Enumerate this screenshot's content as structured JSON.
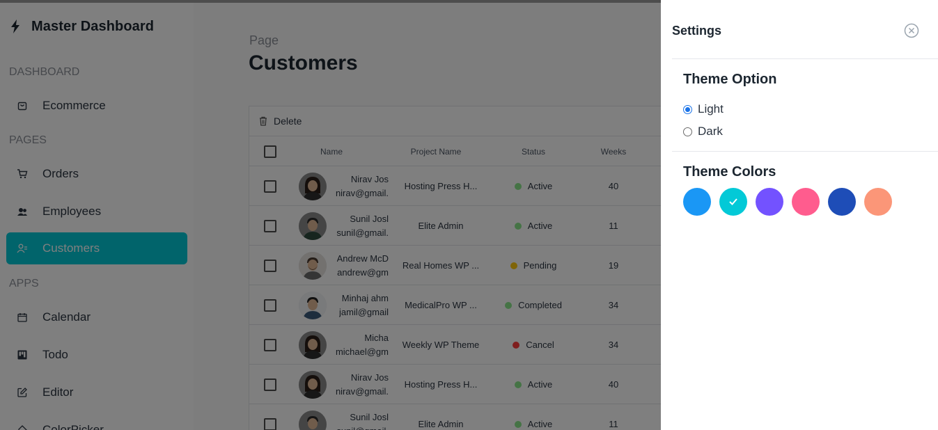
{
  "sidebar": {
    "brand": "Master Dashboard",
    "sections": [
      {
        "title": "Dashboard",
        "items": [
          {
            "label": "Ecommerce",
            "icon": "shopping-bag-icon"
          }
        ]
      },
      {
        "title": "Pages",
        "items": [
          {
            "label": "Orders",
            "icon": "cart-icon"
          },
          {
            "label": "Employees",
            "icon": "employees-icon"
          },
          {
            "label": "Customers",
            "icon": "customers-icon",
            "active": true
          }
        ]
      },
      {
        "title": "Apps",
        "items": [
          {
            "label": "Calendar",
            "icon": "calendar-icon"
          },
          {
            "label": "Todo",
            "icon": "kanban-icon"
          },
          {
            "label": "Editor",
            "icon": "edit-icon"
          },
          {
            "label": "ColorPicker",
            "icon": "color-picker-icon"
          }
        ]
      }
    ]
  },
  "page": {
    "kicker": "Page",
    "title": "Customers"
  },
  "grid": {
    "toolbar_delete": "Delete",
    "headers": {
      "name": "Name",
      "project": "Project Name",
      "status": "Status",
      "weeks": "Weeks"
    },
    "rows": [
      {
        "name": "Nirav Jos",
        "email": "nirav@gmail.",
        "project": "Hosting Press H...",
        "status": "Active",
        "status_color": "#8BE78B",
        "weeks": "40",
        "avatar": "woman"
      },
      {
        "name": "Sunil Josl",
        "email": "sunil@gmail.",
        "project": "Elite Admin",
        "status": "Active",
        "status_color": "#8BE78B",
        "weeks": "11",
        "avatar": "man-dark"
      },
      {
        "name": "Andrew McD",
        "email": "andrew@gm",
        "project": "Real Homes WP ...",
        "status": "Pending",
        "status_color": "#FEC90F",
        "weeks": "19",
        "avatar": "man-beard"
      },
      {
        "name": "Minhaj ahm",
        "email": "jamil@gmail",
        "project": "MedicalPro WP ...",
        "status": "Completed",
        "status_color": "#8BE78B",
        "weeks": "34",
        "avatar": "man-standing"
      },
      {
        "name": "Micha",
        "email": "michael@gm",
        "project": "Weekly WP Theme",
        "status": "Cancel",
        "status_color": "#FF3C3C",
        "weeks": "34",
        "avatar": "woman"
      },
      {
        "name": "Nirav Jos",
        "email": "nirav@gmail.",
        "project": "Hosting Press H...",
        "status": "Active",
        "status_color": "#8BE78B",
        "weeks": "40",
        "avatar": "woman"
      },
      {
        "name": "Sunil Josl",
        "email": "sunil@gmail.",
        "project": "Elite Admin",
        "status": "Active",
        "status_color": "#8BE78B",
        "weeks": "11",
        "avatar": "man-dark"
      }
    ]
  },
  "settings": {
    "title": "Settings",
    "theme_option_title": "Theme Option",
    "options": [
      {
        "label": "Light",
        "checked": true
      },
      {
        "label": "Dark",
        "checked": false
      }
    ],
    "theme_colors_title": "Theme Colors",
    "colors": [
      {
        "color": "#1A97F5",
        "selected": false
      },
      {
        "color": "#03C9D7",
        "selected": true
      },
      {
        "color": "#7352FF",
        "selected": false
      },
      {
        "color": "#FF5C8E",
        "selected": false
      },
      {
        "color": "#1E4DB7",
        "selected": false
      },
      {
        "color": "#FB9678",
        "selected": false
      }
    ]
  }
}
